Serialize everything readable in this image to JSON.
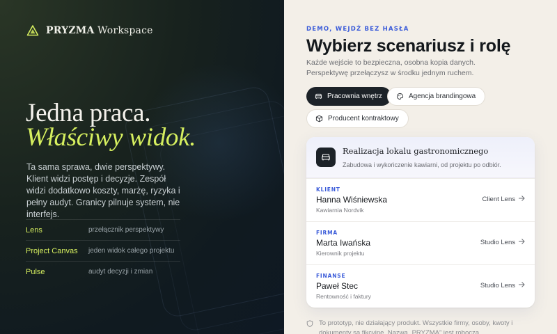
{
  "brand": {
    "name_bold": "PRYZMA",
    "name_rest": " Workspace",
    "icon": "prism-logo-icon",
    "accent": "#d6ef5f"
  },
  "hero": {
    "line1": "Jedna praca.",
    "line2": "Właściwy widok.",
    "intro": "Ta sama sprawa, dwie perspektywy. Klient widzi postęp i decyzje. Zespół widzi dodatkowo koszty, marżę, ryzyka i pełny audyt. Granicy pilnuje system, nie interfejs."
  },
  "features": [
    {
      "name": "Lens",
      "desc": "przełącznik perspektywy"
    },
    {
      "name": "Project Canvas",
      "desc": "jeden widok całego projektu"
    },
    {
      "name": "Pulse",
      "desc": "audyt decyzji i zmian"
    }
  ],
  "chooser": {
    "eyebrow": "DEMO, WEJDŹ BEZ HASŁA",
    "title": "Wybierz scenariusz i rolę",
    "subtitle": "Każde wejście to bezpieczna, osobna kopia danych. Perspektywę przełączysz w środku jednym ruchem."
  },
  "scenarios": [
    {
      "label": "Pracownia wnętrz",
      "icon": "sofa-icon",
      "selected": true
    },
    {
      "label": "Agencja brandingowa",
      "icon": "palette-icon",
      "selected": false
    },
    {
      "label": "Producent kontraktowy",
      "icon": "box-icon",
      "selected": false
    }
  ],
  "case": {
    "title": "Realizacja lokalu gastronomicznego",
    "subtitle": "Zabudowa i wykończenie kawiarni, od projektu po odbiór.",
    "icon": "sofa-icon"
  },
  "roles": [
    {
      "label": "KLIENT",
      "name": "Hanna Wiśniewska",
      "org": "Kawiarnia Nordvik",
      "lens": "Client Lens"
    },
    {
      "label": "FIRMA",
      "name": "Marta Iwańska",
      "org": "Kierownik projektu",
      "lens": "Studio Lens"
    },
    {
      "label": "FINANSE",
      "name": "Paweł Stec",
      "org": "Rentowność i faktury",
      "lens": "Studio Lens"
    }
  ],
  "footnote": "To prototyp, nie działający produkt. Wszystkie firmy, osoby, kwoty i dokumenty są fikcyjne. Nazwa „PRYZMA” jest robocza,",
  "colors": {
    "link_blue": "#3a5bd9",
    "dark": "#1c2228",
    "cream": "#f3efe8"
  }
}
